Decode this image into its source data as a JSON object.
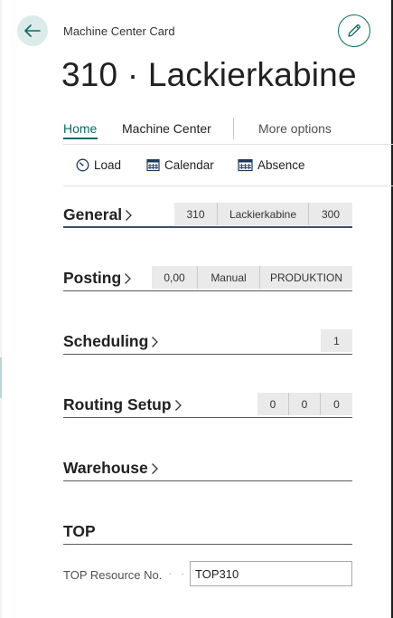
{
  "header": {
    "caption": "Machine Center Card",
    "title": "310 · Lackierkabine"
  },
  "nav": {
    "tabs": [
      {
        "label": "Home",
        "active": true
      },
      {
        "label": "Machine Center",
        "active": false
      }
    ],
    "more_label": "More options"
  },
  "actions": [
    {
      "label": "Load",
      "icon": "load-gauge-icon"
    },
    {
      "label": "Calendar",
      "icon": "calendar-icon"
    },
    {
      "label": "Absence",
      "icon": "absence-calendar-icon"
    }
  ],
  "sections": {
    "general": {
      "title": "General",
      "summary": [
        "310",
        "Lackierkabine",
        "300"
      ]
    },
    "posting": {
      "title": "Posting",
      "summary": [
        "0,00",
        "Manual",
        "PRODUKTION"
      ]
    },
    "scheduling": {
      "title": "Scheduling",
      "summary": [
        "1"
      ]
    },
    "routing": {
      "title": "Routing Setup",
      "summary": [
        "0",
        "0",
        "0"
      ]
    },
    "warehouse": {
      "title": "Warehouse",
      "summary": []
    },
    "top": {
      "title": "TOP",
      "field_label": "TOP Resource No.",
      "field_value": "TOP310"
    }
  },
  "colors": {
    "accent": "#0b6a63",
    "back_button_bg": "#dcebea",
    "chip_bg": "#eaeaea"
  }
}
